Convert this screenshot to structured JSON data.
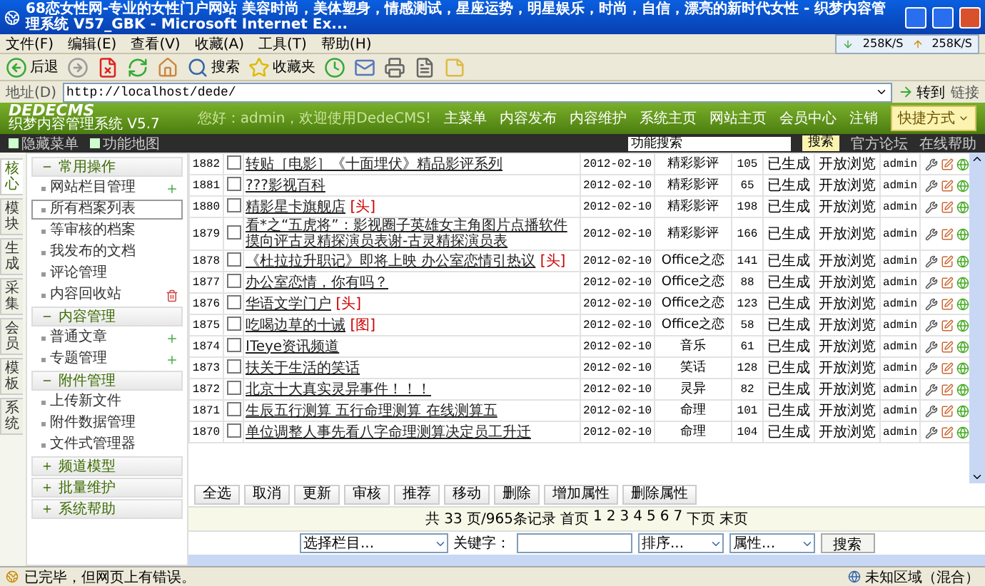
{
  "window": {
    "title": "68恋女性网-专业的女性门户网站 美容时尚，美体塑身，情感测试，星座运势，明星娱乐，时尚，自信，漂亮的新时代女性 - 织梦内容管理系统 V57_GBK - Microsoft Internet Ex..."
  },
  "menu": [
    "文件(F)",
    "编辑(E)",
    "查看(V)",
    "收藏(A)",
    "工具(T)",
    "帮助(H)"
  ],
  "net_meter": {
    "down": "258K/S",
    "up": "258K/S"
  },
  "toolbar": [
    {
      "kind": "back",
      "label": "后退"
    },
    {
      "kind": "forward"
    },
    {
      "kind": "stop"
    },
    {
      "kind": "refresh"
    },
    {
      "kind": "home"
    },
    {
      "kind": "search",
      "label": "搜索"
    },
    {
      "kind": "favorites",
      "label": "收藏夹"
    },
    {
      "kind": "history"
    },
    {
      "kind": "mail"
    },
    {
      "kind": "print"
    },
    {
      "kind": "edit"
    },
    {
      "kind": "note"
    }
  ],
  "address": {
    "label": "地址(D)",
    "url": "http://localhost/dede/",
    "go": "转到",
    "links": "链接"
  },
  "header": {
    "logo": "DEDECMS",
    "logo_sub": "织梦内容管理系统 V5.7",
    "greeting": "您好：admin，欢迎使用DedeCMS!",
    "nav": [
      "主菜单",
      "内容发布",
      "内容维护",
      "系统主页",
      "网站主页",
      "会员中心",
      "注销"
    ],
    "quick": "快捷方式"
  },
  "subbar": {
    "links": [
      "隐藏菜单",
      "功能地图"
    ],
    "search_value": "功能搜索",
    "search_button": "搜索",
    "help_links": [
      "官方论坛",
      "在线帮助"
    ]
  },
  "side_tabs": [
    {
      "label": "核心",
      "selected": true
    },
    {
      "label": "模块",
      "selected": false
    },
    {
      "label": "生成",
      "selected": false
    },
    {
      "label": "采集",
      "selected": false
    },
    {
      "label": "会员",
      "selected": false
    },
    {
      "label": "模板",
      "selected": false
    },
    {
      "label": "系统",
      "selected": false
    }
  ],
  "menu_groups": [
    {
      "title": "常用操作",
      "expanded": true,
      "items": [
        {
          "label": "网站栏目管理",
          "selected": false,
          "kind": "add"
        },
        {
          "label": "所有档案列表",
          "selected": true
        },
        {
          "label": "等审核的档案",
          "selected": false
        },
        {
          "label": "我发布的文档",
          "selected": false
        },
        {
          "label": "评论管理",
          "selected": false
        },
        {
          "label": "内容回收站",
          "selected": false,
          "kind": "trash"
        }
      ]
    },
    {
      "title": "内容管理",
      "expanded": true,
      "items": [
        {
          "label": "普通文章",
          "selected": false,
          "kind": "add"
        },
        {
          "label": "专题管理",
          "selected": false,
          "kind": "add"
        }
      ]
    },
    {
      "title": "附件管理",
      "expanded": true,
      "items": [
        {
          "label": "上传新文件",
          "selected": false
        },
        {
          "label": "附件数据管理",
          "selected": false
        },
        {
          "label": "文件式管理器",
          "selected": false
        }
      ]
    },
    {
      "title": "频道模型",
      "expanded": false
    },
    {
      "title": "批量维护",
      "expanded": false
    },
    {
      "title": "系统帮助",
      "expanded": false
    }
  ],
  "rows": [
    {
      "id": "1882",
      "checked": false,
      "title": "转贴［电影］《十面埋伏》精品影评系列",
      "date": "2012-02-10",
      "category": "精彩影评",
      "clicks": "105",
      "status": "已生成",
      "access": "开放浏览",
      "author": "admin"
    },
    {
      "id": "1881",
      "checked": false,
      "title": "???影视百科",
      "date": "2012-02-10",
      "category": "精彩影评",
      "clicks": "65",
      "status": "已生成",
      "access": "开放浏览",
      "author": "admin"
    },
    {
      "id": "1880",
      "checked": false,
      "title": "精影星卡旗舰店",
      "tag": "[头]",
      "date": "2012-02-10",
      "category": "精彩影评",
      "clicks": "198",
      "status": "已生成",
      "access": "开放浏览",
      "author": "admin"
    },
    {
      "id": "1879",
      "checked": false,
      "title": "看*之“五虎将”：影视圈子英雄女主角图片点播软件摸向评古灵精探演员表谢-古灵精探演员表",
      "date": "2012-02-10",
      "category": "精彩影评",
      "clicks": "166",
      "status": "已生成",
      "access": "开放浏览",
      "author": "admin"
    },
    {
      "id": "1878",
      "checked": false,
      "title": "《杜拉拉升职记》即将上映 办公室恋情引热议",
      "tag": "[头]",
      "date": "2012-02-10",
      "category": "Office之恋",
      "clicks": "141",
      "status": "已生成",
      "access": "开放浏览",
      "author": "admin"
    },
    {
      "id": "1877",
      "checked": false,
      "title": "办公室恋情，你有吗？",
      "date": "2012-02-10",
      "category": "Office之恋",
      "clicks": "88",
      "status": "已生成",
      "access": "开放浏览",
      "author": "admin"
    },
    {
      "id": "1876",
      "checked": false,
      "title": "华语文学门户",
      "tag": "[头]",
      "date": "2012-02-10",
      "category": "Office之恋",
      "clicks": "123",
      "status": "已生成",
      "access": "开放浏览",
      "author": "admin"
    },
    {
      "id": "1875",
      "checked": false,
      "title": "吃喝边草的十诫",
      "tag": "[图]",
      "date": "2012-02-10",
      "category": "Office之恋",
      "clicks": "58",
      "status": "已生成",
      "access": "开放浏览",
      "author": "admin"
    },
    {
      "id": "1874",
      "checked": false,
      "title": "ITeye资讯频道",
      "date": "2012-02-10",
      "category": "音乐",
      "clicks": "61",
      "status": "已生成",
      "access": "开放浏览",
      "author": "admin"
    },
    {
      "id": "1873",
      "checked": false,
      "title": "扶关于生活的笑话",
      "date": "2012-02-10",
      "category": "笑话",
      "clicks": "128",
      "status": "已生成",
      "access": "开放浏览",
      "author": "admin"
    },
    {
      "id": "1872",
      "checked": false,
      "title": "北京十大真实灵异事件！！！",
      "date": "2012-02-10",
      "category": "灵异",
      "clicks": "82",
      "status": "已生成",
      "access": "开放浏览",
      "author": "admin"
    },
    {
      "id": "1871",
      "checked": false,
      "title": "生辰五行测算 五行命理测算 在线测算五",
      "date": "2012-02-10",
      "category": "命理",
      "clicks": "101",
      "status": "已生成",
      "access": "开放浏览",
      "author": "admin"
    },
    {
      "id": "1870",
      "checked": false,
      "title": "单位调整人事先看八字命理测算决定员工升迁",
      "date": "2012-02-10",
      "category": "命理",
      "clicks": "104",
      "status": "已生成",
      "access": "开放浏览",
      "author": "admin"
    }
  ],
  "actions": [
    "全选",
    "取消",
    "更新",
    "审核",
    "推荐",
    "移动",
    "删除",
    "增加属性",
    "删除属性"
  ],
  "pagination": {
    "summary": "共 33 页/965条记录",
    "links": [
      "首页",
      "1",
      "2",
      "3",
      "4",
      "5",
      "6",
      "7",
      "下页",
      "末页"
    ]
  },
  "search": {
    "column": "选择栏目...",
    "keyword_label": "关键字：",
    "order": "排序...",
    "attribute": "属性...",
    "button": "搜索"
  },
  "status_bar": {
    "text": "已完毕，但网页上有错误。",
    "zone": "未知区域（混合）"
  }
}
